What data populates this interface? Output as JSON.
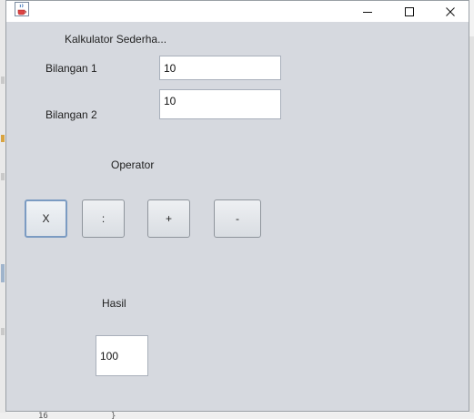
{
  "window": {
    "icon": "java-coffee-icon",
    "controls": {
      "minimize": "minimize-icon",
      "maximize": "maximize-icon",
      "close": "close-icon"
    }
  },
  "form": {
    "heading": "Kalkulator Sederha...",
    "bilangan1_label": "Bilangan 1",
    "bilangan1_value": "10",
    "bilangan2_label": "Bilangan 2",
    "bilangan2_value": "10",
    "operator_label": "Operator",
    "operators": [
      "X",
      ":",
      "+",
      "-"
    ],
    "hasil_label": "Hasil",
    "hasil_value": "100"
  },
  "background": {
    "bottom_line_number": "16",
    "bottom_brace": "}"
  },
  "colors": {
    "window_bg": "#d6d9df",
    "titlebar_bg": "#ffffff",
    "button_border": "#8f959c",
    "focus_border": "#7b9bc2"
  }
}
